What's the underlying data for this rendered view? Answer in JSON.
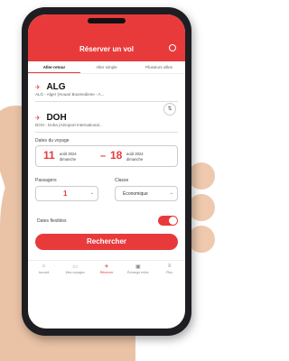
{
  "header": {
    "title": "Réserver un vol"
  },
  "tabs": [
    {
      "label": "Aller-retour",
      "active": true
    },
    {
      "label": "Aller simple",
      "active": false
    },
    {
      "label": "Plusieurs villes",
      "active": false
    }
  ],
  "origin": {
    "code": "ALG",
    "airport": "ALG - Alger (Houari Boumediene - A..."
  },
  "destination": {
    "code": "DOH",
    "airport": "DOH - Doha (Aéroport International..."
  },
  "dates": {
    "label": "Dates du voyage",
    "depart_day": "11",
    "depart_text1": "août 2024",
    "depart_text2": "dimanche",
    "return_day": "18",
    "return_text1": "août 2024",
    "return_text2": "dimanche"
  },
  "passengers": {
    "label": "Passagers",
    "value": "1"
  },
  "cabin": {
    "label": "Classe",
    "value": "Économique"
  },
  "flexible": {
    "label": "Dates flexibles",
    "enabled": true
  },
  "search_button": "Rechercher",
  "nav": [
    {
      "label": "Accueil",
      "icon": "home-icon",
      "active": false
    },
    {
      "label": "Mes voyages",
      "icon": "trips-icon",
      "active": false
    },
    {
      "label": "Réserver",
      "icon": "plane-icon",
      "active": true
    },
    {
      "label": "Échange miles",
      "icon": "miles-icon",
      "active": false
    },
    {
      "label": "Plus",
      "icon": "menu-icon",
      "active": false
    }
  ],
  "colors": {
    "accent": "#e83a3b"
  }
}
